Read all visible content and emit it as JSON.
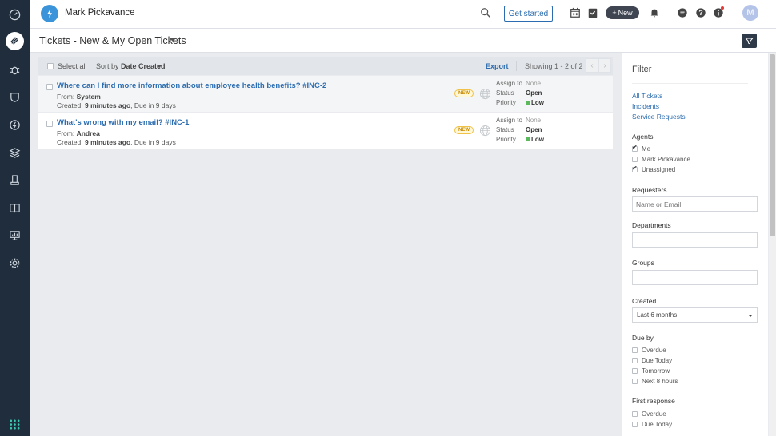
{
  "topbar": {
    "workspace_name": "Mark Pickavance",
    "get_started_label": "Get started",
    "new_label": "New",
    "avatar_initial": "M"
  },
  "subheader": {
    "title": "Tickets - New & My Open Tickets"
  },
  "toolbar": {
    "select_all_label": "Select all",
    "sort_prefix": "Sort by",
    "sort_value": "Date Created",
    "export_label": "Export",
    "showing_text": "Showing 1 - 2 of 2"
  },
  "tickets": [
    {
      "subject": "Where can I find more information about employee health benefits? #INC-2",
      "from_label": "From:",
      "from": "System",
      "created_label": "Created:",
      "created": "9 minutes ago",
      "due": ", Due in 9 days",
      "badge": "NEW",
      "assign_to_label": "Assign to",
      "assign_to": "None",
      "status_label": "Status",
      "status": "Open",
      "priority_label": "Priority",
      "priority": "Low"
    },
    {
      "subject": "What's wrong with my email? #INC-1",
      "from_label": "From:",
      "from": "Andrea",
      "created_label": "Created:",
      "created": "9 minutes ago",
      "due": ", Due in 9 days",
      "badge": "NEW",
      "assign_to_label": "Assign to",
      "assign_to": "None",
      "status_label": "Status",
      "status": "Open",
      "priority_label": "Priority",
      "priority": "Low"
    }
  ],
  "filter": {
    "title": "Filter",
    "links": [
      "All Tickets",
      "Incidents",
      "Service Requests"
    ],
    "agents_label": "Agents",
    "agents": [
      {
        "label": "Me",
        "checked": true
      },
      {
        "label": "Mark Pickavance",
        "checked": false
      },
      {
        "label": "Unassigned",
        "checked": true
      }
    ],
    "requesters_label": "Requesters",
    "requesters_placeholder": "Name or Email",
    "departments_label": "Departments",
    "groups_label": "Groups",
    "created_label": "Created",
    "created_value": "Last 6 months",
    "due_by_label": "Due by",
    "due_by": [
      "Overdue",
      "Due Today",
      "Tomorrow",
      "Next 8 hours"
    ],
    "first_response_label": "First response",
    "first_response": [
      "Overdue",
      "Due Today"
    ]
  },
  "colors": {
    "sidebar": "#1f2d3d",
    "accent": "#2b6cb0",
    "priority_low": "#5cb85c"
  }
}
